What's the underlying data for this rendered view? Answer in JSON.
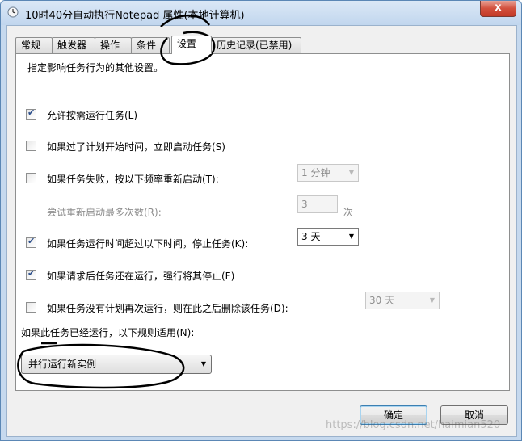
{
  "window": {
    "title": "10时40分自动执行Notepad 属性(本地计算机)",
    "close_glyph": "x"
  },
  "tabs": [
    {
      "label": "常规"
    },
    {
      "label": "触发器"
    },
    {
      "label": "操作"
    },
    {
      "label": "条件"
    },
    {
      "label": "设置",
      "active": true
    },
    {
      "label": "历史记录(已禁用)"
    }
  ],
  "settings": {
    "description": "指定影响任务行为的其他设置。",
    "allow_on_demand": {
      "label": "允许按需运行任务(L)",
      "checked": true
    },
    "start_missed": {
      "label": "如果过了计划开始时间，立即启动任务(S)",
      "checked": false
    },
    "restart_on_failure": {
      "label": "如果任务失败，按以下频率重新启动(T):",
      "checked": false,
      "interval": "1 分钟"
    },
    "restart_attempts": {
      "label": "尝试重新启动最多次数(R):",
      "value": "3",
      "unit": "次"
    },
    "stop_if_runs_longer": {
      "label": "如果任务运行时间超过以下时间，停止任务(K):",
      "checked": true,
      "duration": "3 天"
    },
    "force_stop": {
      "label": "如果请求后任务还在运行，强行将其停止(F)",
      "checked": true
    },
    "delete_if_not_scheduled": {
      "label": "如果任务没有计划再次运行，则在此之后删除该任务(D):",
      "checked": false,
      "duration": "30 天"
    },
    "multiple_instances": {
      "label": "如果此任务已经运行，以下规则适用(N):",
      "value": "并行运行新实例"
    }
  },
  "buttons": {
    "ok": "确定",
    "cancel": "取消"
  },
  "watermark": "https://blog.csdn.net/haimian520"
}
